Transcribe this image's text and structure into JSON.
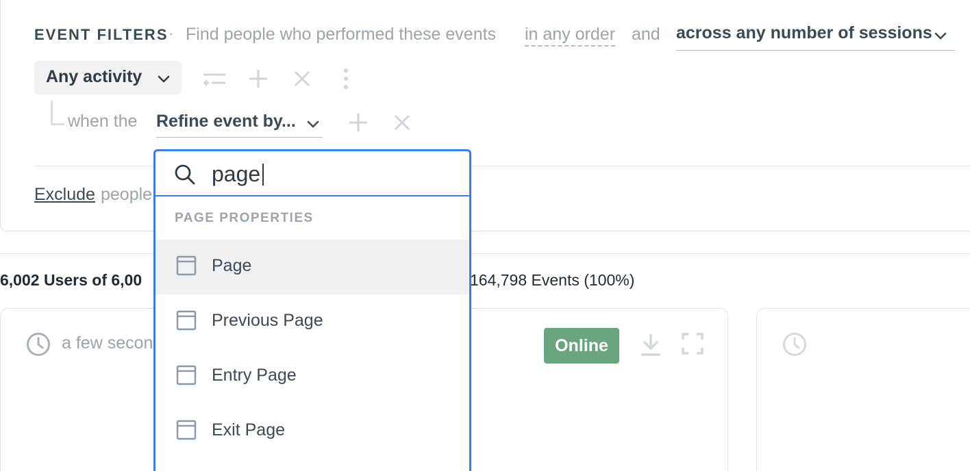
{
  "filters": {
    "section_label": "EVENT FILTERS",
    "separator": "·",
    "description": "Find people who performed these events",
    "order_link": "in any order",
    "and_text": "and",
    "sessions_select": "across any number of sessions",
    "activity_select": "Any activity",
    "refine_prefix": "when the",
    "refine_select": "Refine event by...",
    "exclude_link": "Exclude",
    "exclude_rest": "people"
  },
  "summary": {
    "users_text": "6,002 Users of 6,00",
    "events_text": "164,798 Events (100%)"
  },
  "card": {
    "timestamp": "a few secon",
    "status_badge": "Online",
    "badge_color": "#6ba57f"
  },
  "dropdown": {
    "search_value": "page",
    "section_header": "PAGE PROPERTIES",
    "options": [
      {
        "label": "Page"
      },
      {
        "label": "Previous Page"
      },
      {
        "label": "Entry Page"
      },
      {
        "label": "Exit Page"
      }
    ],
    "accent_color": "#3b7de0"
  }
}
